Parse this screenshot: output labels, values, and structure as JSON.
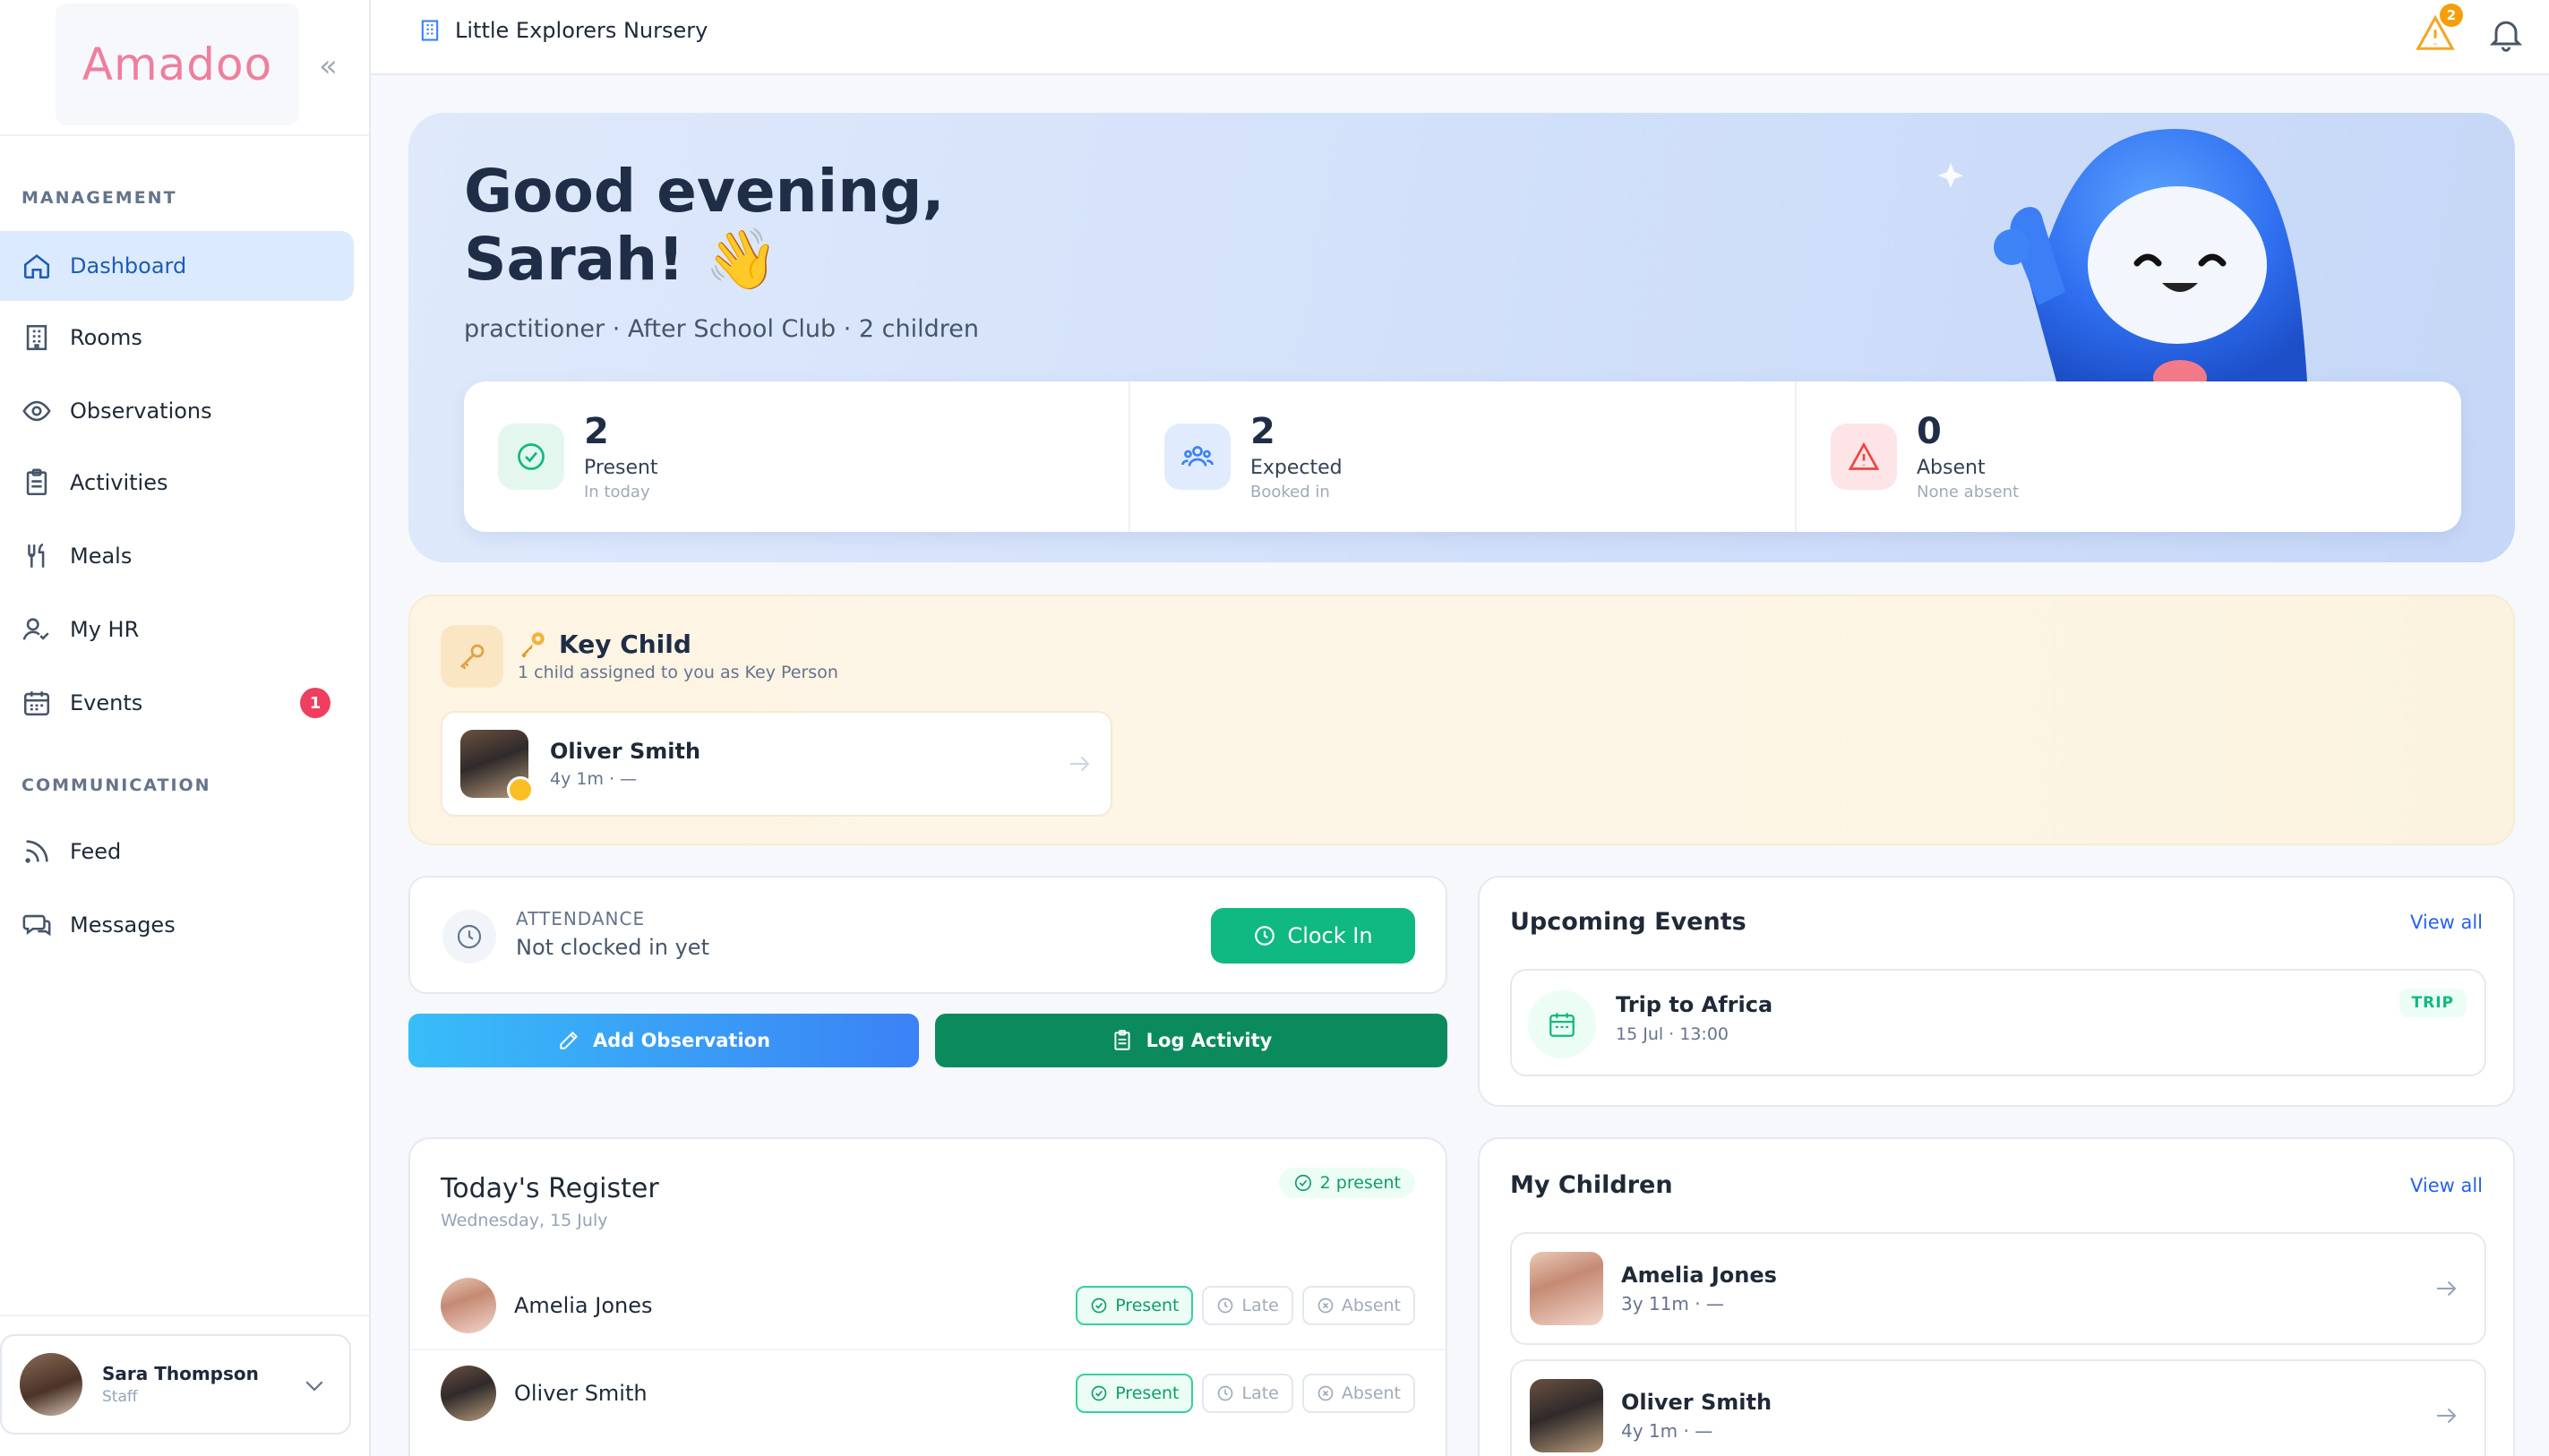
{
  "brand": {
    "logo": "Amadoo"
  },
  "sidebar": {
    "sections": [
      {
        "label": "MANAGEMENT"
      },
      {
        "label": "COMMUNICATION"
      }
    ],
    "items": [
      {
        "label": "Dashboard",
        "icon": "home-icon"
      },
      {
        "label": "Rooms",
        "icon": "building-icon"
      },
      {
        "label": "Observations",
        "icon": "eye-icon"
      },
      {
        "label": "Activities",
        "icon": "clipboard-icon"
      },
      {
        "label": "Meals",
        "icon": "utensils-icon"
      },
      {
        "label": "My HR",
        "icon": "user-check-icon"
      },
      {
        "label": "Events",
        "icon": "calendar-icon",
        "badge": "1"
      },
      {
        "label": "Feed",
        "icon": "rss-icon"
      },
      {
        "label": "Messages",
        "icon": "messages-icon"
      }
    ],
    "user": {
      "name": "Sara Thompson",
      "role": "Staff"
    }
  },
  "topbar": {
    "org_name": "Little Explorers Nursery",
    "alert_count": "2"
  },
  "hero": {
    "greeting_line1": "Good evening,",
    "greeting_line2": "Sarah! 👋",
    "subtitle": "practitioner · After School Club · 2 children",
    "stats": [
      {
        "value": "2",
        "label": "Present",
        "hint": "In today",
        "color": "#10b981"
      },
      {
        "value": "2",
        "label": "Expected",
        "hint": "Booked in",
        "color": "#3b82f6"
      },
      {
        "value": "0",
        "label": "Absent",
        "hint": "None absent",
        "color": "#ef4444"
      }
    ]
  },
  "key_child": {
    "title": "Key Child",
    "subtitle": "1 child assigned to you as Key Person",
    "child": {
      "name": "Oliver Smith",
      "sub": "4y 1m · —"
    }
  },
  "attendance": {
    "label": "ATTENDANCE",
    "status": "Not clocked in yet",
    "clock_in": "Clock In"
  },
  "actions": {
    "add_observation": "Add Observation",
    "log_activity": "Log Activity"
  },
  "events": {
    "title": "Upcoming Events",
    "view_all": "View all",
    "items": [
      {
        "title": "Trip to Africa",
        "time": "15 Jul · 13:00",
        "tag": "TRIP"
      }
    ]
  },
  "register": {
    "title": "Today's Register",
    "date": "Wednesday, 15 July",
    "badge": "2 present",
    "rows": [
      {
        "name": "Amelia Jones",
        "present": "Present",
        "late": "Late",
        "absent": "Absent",
        "status": "Present"
      },
      {
        "name": "Oliver Smith",
        "present": "Present",
        "late": "Late",
        "absent": "Absent",
        "status": "Present"
      }
    ]
  },
  "my_children": {
    "title": "My Children",
    "view_all": "View all",
    "items": [
      {
        "name": "Amelia Jones",
        "sub": "3y 11m · —"
      },
      {
        "name": "Oliver Smith",
        "sub": "4y 1m · —"
      }
    ]
  },
  "colors": {
    "accent": "#3b82f6",
    "success": "#10b981",
    "danger": "#ef3e5f",
    "warning": "#f59e0b"
  }
}
